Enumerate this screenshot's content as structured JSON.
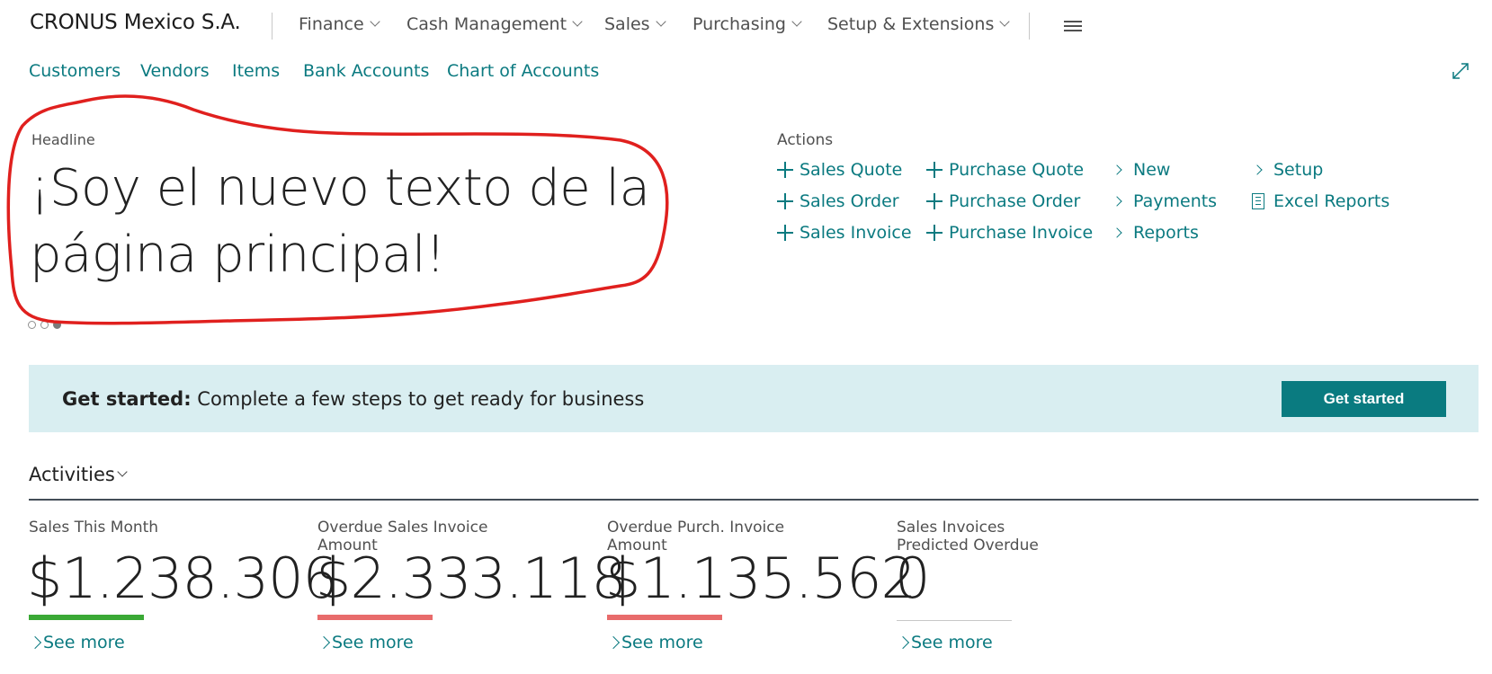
{
  "header": {
    "company": "CRONUS Mexico S.A.",
    "menus": [
      "Finance",
      "Cash Management",
      "Sales",
      "Purchasing",
      "Setup & Extensions"
    ],
    "quick_links": [
      "Customers",
      "Vendors",
      "Items",
      "Bank Accounts",
      "Chart of Accounts"
    ]
  },
  "headline": {
    "label": "Headline",
    "text": "¡Soy el nuevo texto de la página principal!",
    "dots_total": 3,
    "active_dot": 3
  },
  "actions": {
    "label": "Actions",
    "col1": [
      "Sales Quote",
      "Sales Order",
      "Sales Invoice"
    ],
    "col2": [
      "Purchase Quote",
      "Purchase Order",
      "Purchase Invoice"
    ],
    "col3": [
      "New",
      "Payments",
      "Reports"
    ],
    "col4": [
      "Setup",
      "Excel Reports"
    ]
  },
  "banner": {
    "bold": "Get started:",
    "text": " Complete a few steps to get ready for business",
    "button": "Get started"
  },
  "activities": {
    "title": "Activities",
    "see_more": "See more",
    "tiles": [
      {
        "label": "Sales This Month",
        "value": "$1.238.306",
        "status_color": "#3aa935"
      },
      {
        "label": "Overdue Sales Invoice Amount",
        "value": "$2.333.118",
        "status_color": "#e86b6b"
      },
      {
        "label": "Overdue Purch. Invoice Amount",
        "value": "$1.135.562",
        "status_color": "#e86b6b"
      },
      {
        "label": "Sales Invoices Predicted Overdue",
        "value": "0",
        "status_color": "#c8c8c8"
      }
    ]
  },
  "colors": {
    "accent": "#0b7a80",
    "annotation": "#e0201e"
  }
}
